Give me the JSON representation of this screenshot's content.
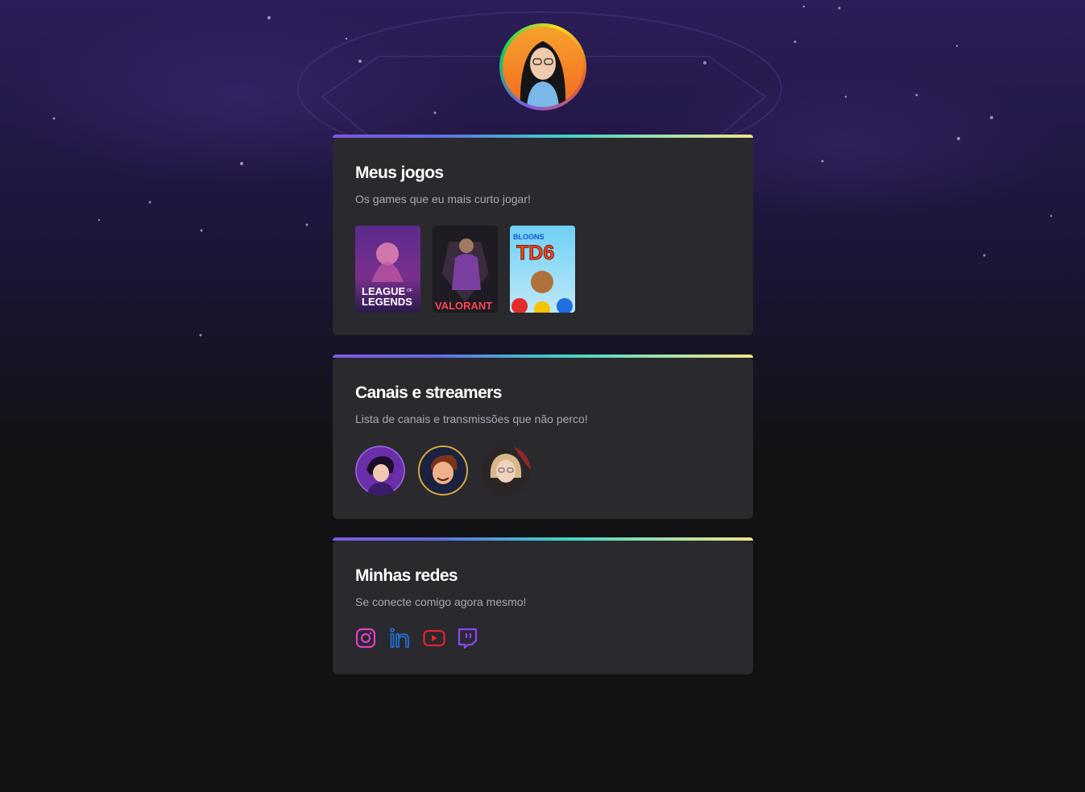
{
  "profile": {
    "avatar_alt": "Foto de perfil"
  },
  "sections": {
    "games": {
      "title": "Meus jogos",
      "subtitle": "Os games que eu mais curto jogar!",
      "items": [
        {
          "name": "League of Legends",
          "line1": "LEAGUE",
          "line2": "LEGENDS",
          "small": "OF"
        },
        {
          "name": "Valorant",
          "line1": "VALORANT"
        },
        {
          "name": "Bloons TD 6",
          "line1": "BLOONS",
          "line2": "TD6"
        }
      ]
    },
    "streamers": {
      "title": "Canais e streamers",
      "subtitle": "Lista de canais e transmissões que não perco!",
      "items": [
        {
          "name": "streamer-1"
        },
        {
          "name": "streamer-2"
        },
        {
          "name": "streamer-3"
        }
      ]
    },
    "socials": {
      "title": "Minhas redes",
      "subtitle": "Se conecte comigo agora mesmo!",
      "items": [
        {
          "icon": "instagram-icon",
          "color": "#e23dc8"
        },
        {
          "icon": "linkedin-icon",
          "color": "#1f6fd1"
        },
        {
          "icon": "youtube-icon",
          "color": "#e0262d"
        },
        {
          "icon": "twitch-icon",
          "color": "#8c44f7"
        }
      ]
    }
  },
  "colors": {
    "background": "#121214",
    "card": "#29292e",
    "title": "#ffffff",
    "subtitle": "#a8a8b3"
  }
}
